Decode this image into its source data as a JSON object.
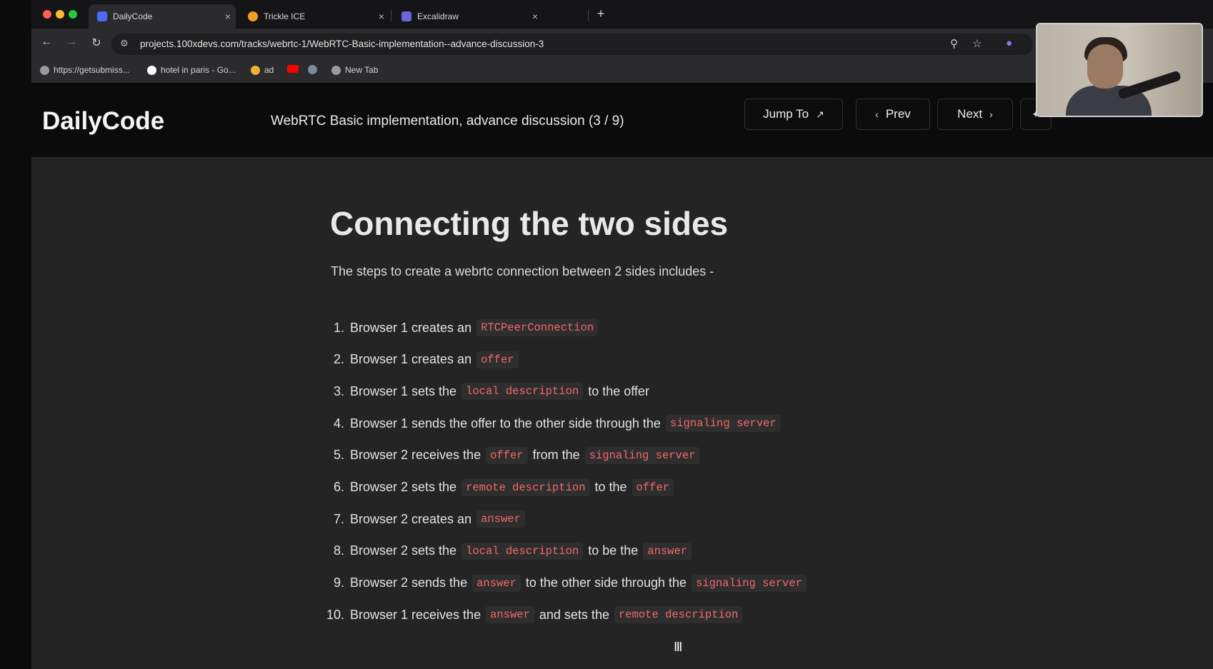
{
  "browser": {
    "tabs": [
      {
        "title": "DailyCode",
        "active": true,
        "favicon_color": "#4a6cf7"
      },
      {
        "title": "Trickle ICE",
        "active": false,
        "favicon_color": "#f0a020"
      },
      {
        "title": "Excalidraw",
        "active": false,
        "favicon_color": "#6965db"
      }
    ],
    "new_tab_label": "+",
    "close_label": "×",
    "url": "projects.100xdevs.com/tracks/webrtc-1/WebRTC-Basic-implementation--advance-discussion-3",
    "bookmarks": [
      {
        "label": "https://getsubmiss...",
        "icon_color": "#9a9a9a"
      },
      {
        "label": "hotel in paris - Go...",
        "icon_color": "#ffffff"
      },
      {
        "label": "ad",
        "icon_color": "#f0b030"
      },
      {
        "label": "",
        "icon_color": "#ff0000"
      },
      {
        "label": "",
        "icon_color": "#7a8aa0"
      },
      {
        "label": "New Tab",
        "icon_color": "#9a9a9a"
      }
    ]
  },
  "header": {
    "brand": "DailyCode",
    "lesson_title": "WebRTC Basic implementation, advance discussion (3 / 9)",
    "jump_to_label": "Jump To",
    "prev_label": "Prev",
    "next_label": "Next"
  },
  "content": {
    "heading": "Connecting the two sides",
    "intro": "The steps to create a webrtc connection between 2 sides includes -",
    "steps": [
      {
        "num": "1.",
        "parts": [
          {
            "t": "Browser 1 creates an"
          },
          {
            "c": "RTCPeerConnection"
          }
        ]
      },
      {
        "num": "2.",
        "parts": [
          {
            "t": "Browser 1 creates an"
          },
          {
            "c": "offer"
          }
        ]
      },
      {
        "num": "3.",
        "parts": [
          {
            "t": "Browser 1 sets the"
          },
          {
            "c": "local description"
          },
          {
            "t": "to the offer"
          }
        ]
      },
      {
        "num": "4.",
        "parts": [
          {
            "t": "Browser 1 sends the offer to the other side through the"
          },
          {
            "c": "signaling server"
          }
        ]
      },
      {
        "num": "5.",
        "parts": [
          {
            "t": "Browser 2 receives the"
          },
          {
            "c": "offer"
          },
          {
            "t": "from the"
          },
          {
            "c": "signaling server"
          }
        ]
      },
      {
        "num": "6.",
        "parts": [
          {
            "t": "Browser 2 sets the"
          },
          {
            "c": "remote description"
          },
          {
            "t": "to the"
          },
          {
            "c": "offer"
          }
        ]
      },
      {
        "num": "7.",
        "parts": [
          {
            "t": "Browser 2 creates an"
          },
          {
            "c": "answer"
          }
        ]
      },
      {
        "num": "8.",
        "parts": [
          {
            "t": "Browser 2 sets the"
          },
          {
            "c": "local description"
          },
          {
            "t": "to be the"
          },
          {
            "c": "answer"
          }
        ]
      },
      {
        "num": "9.",
        "parts": [
          {
            "t": "Browser 2 sends the"
          },
          {
            "c": "answer"
          },
          {
            "t": "to the other side through the"
          },
          {
            "c": "signaling server"
          }
        ]
      },
      {
        "num": "10.",
        "parts": [
          {
            "t": "Browser 1 receives the"
          },
          {
            "c": "answer"
          },
          {
            "t": "and sets the"
          },
          {
            "c": "remote description"
          }
        ]
      }
    ]
  },
  "colors": {
    "code_text": "#f06a6a",
    "code_bg": "#2e2e2e",
    "page_bg": "#242424",
    "header_bg": "#0b0b0b"
  }
}
